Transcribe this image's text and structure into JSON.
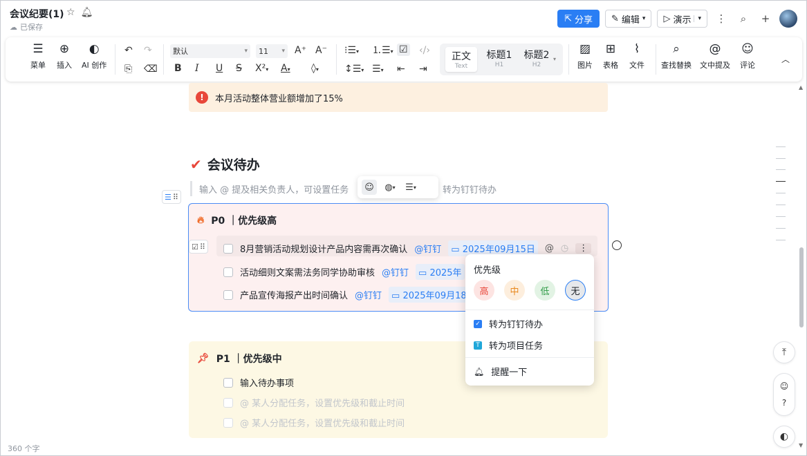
{
  "header": {
    "title": "会议纪要(1)",
    "saved": "已保存",
    "share": "分享",
    "edit": "编辑",
    "present": "演示"
  },
  "toolbar": {
    "menu": "菜单",
    "insert": "插入",
    "ai": "AI 创作",
    "font": "默认",
    "size": "11",
    "styles": [
      {
        "main": "正文",
        "sub": "Text"
      },
      {
        "main": "标题1",
        "sub": "H1"
      },
      {
        "main": "标题2",
        "sub": "H2"
      }
    ],
    "image": "图片",
    "table": "表格",
    "file": "文件",
    "find": "查找替换",
    "mention": "文中提及",
    "comment": "评论"
  },
  "doc": {
    "alert": "本月活动整体营业额增加了15%",
    "section_title": "会议待办",
    "hint": "输入 @ 提及相关负责人，可设置任务",
    "hint_suffix": "转为钉钉待办"
  },
  "p0": {
    "title": "P0 ｜优先级高",
    "items": [
      {
        "text": "8月营销活动规划设计产品内容需再次确认",
        "mention": "@钉钉",
        "date": "2025年09月15日"
      },
      {
        "text": "活动细则文案需法务同学协助审核",
        "mention": "@钉钉",
        "date": "2025年"
      },
      {
        "text": "产品宣传海报产出时间确认",
        "mention": "@钉钉",
        "date": "2025年09月18"
      }
    ]
  },
  "p1": {
    "title": "P1 ｜优先级中",
    "items": [
      {
        "text": "输入待办事项"
      },
      {
        "text": "@ 某人分配任务，设置优先级和截止时间"
      },
      {
        "text": "@ 某人分配任务，设置优先级和截止时间"
      }
    ]
  },
  "menu": {
    "title": "优先级",
    "priorities": [
      "高",
      "中",
      "低",
      "无"
    ],
    "to_dingtalk": "转为钉钉待办",
    "to_project": "转为项目任务",
    "remind": "提醒一下"
  },
  "footer": {
    "word_count": "360 个字"
  },
  "colors": {
    "accent": "#2a7ef4",
    "alert_bg": "#fdf0e0",
    "p0_bg": "#fdf0f0",
    "p1_bg": "#fdf8e4"
  }
}
